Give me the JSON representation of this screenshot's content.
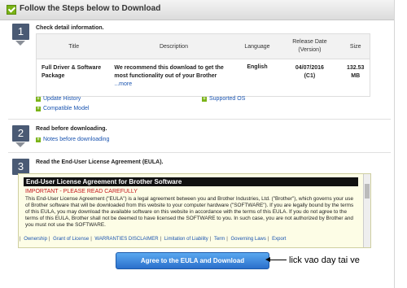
{
  "header": {
    "title": "Follow the Steps below to Download"
  },
  "step1": {
    "number": "1",
    "title": "Check detail information.",
    "table": {
      "headers": {
        "title": "Title",
        "description": "Description",
        "language": "Language",
        "release_date": "Release Date\n(Version)",
        "size": "Size"
      },
      "row": {
        "title": "Full Driver & Software Package",
        "description": "We recommend this download to get the most functionality out of your Brother",
        "more": "...more",
        "language": "English",
        "date": "04/07/2016",
        "version": "(C1)",
        "size": "132.53 MB"
      }
    },
    "links": {
      "update_history": "Update History",
      "supported_os": "Supported OS",
      "compatible_model": "Compatible Model"
    }
  },
  "step2": {
    "number": "2",
    "title": "Read before downloading.",
    "link": "Notes before downloading"
  },
  "step3": {
    "number": "3",
    "title": "Read the End-User License Agreement (EULA).",
    "eula": {
      "heading": "End-User License Agreement for Brother Software",
      "important": "IMPORTANT - PLEASE READ CAREFULLY",
      "body": "This End-User License Agreement (\"EULA\") is a legal agreement between you and Brother Industries, Ltd. (\"Brother\"), which governs your use of Brother software that will be downloaded from this website to your computer hardware (\"SOFTWARE\"). If you are legally bound by the terms of this EULA, you may download the available software on this website in accordance with the terms of this EULA. If you do not agree to the terms of this EULA, Brother shall not be deemed to have licensed the SOFTWARE to you. In such case, you are not authorized by Brother and you must not use the SOFTWARE.",
      "links": [
        "Ownership",
        "Grant of License",
        "WARRANTIES DISCLAIMER",
        "Limitation of Liability",
        "Term",
        "Governing Laws",
        "Export"
      ]
    },
    "agree_button": "Agree to the EULA and Download"
  },
  "annotation": {
    "text": "lick vao day tai ve"
  },
  "colors": {
    "accent_blue": "#2b6fcb",
    "step_badge": "#4a5a74",
    "link": "#1a54b0",
    "important": "#c4161c"
  }
}
